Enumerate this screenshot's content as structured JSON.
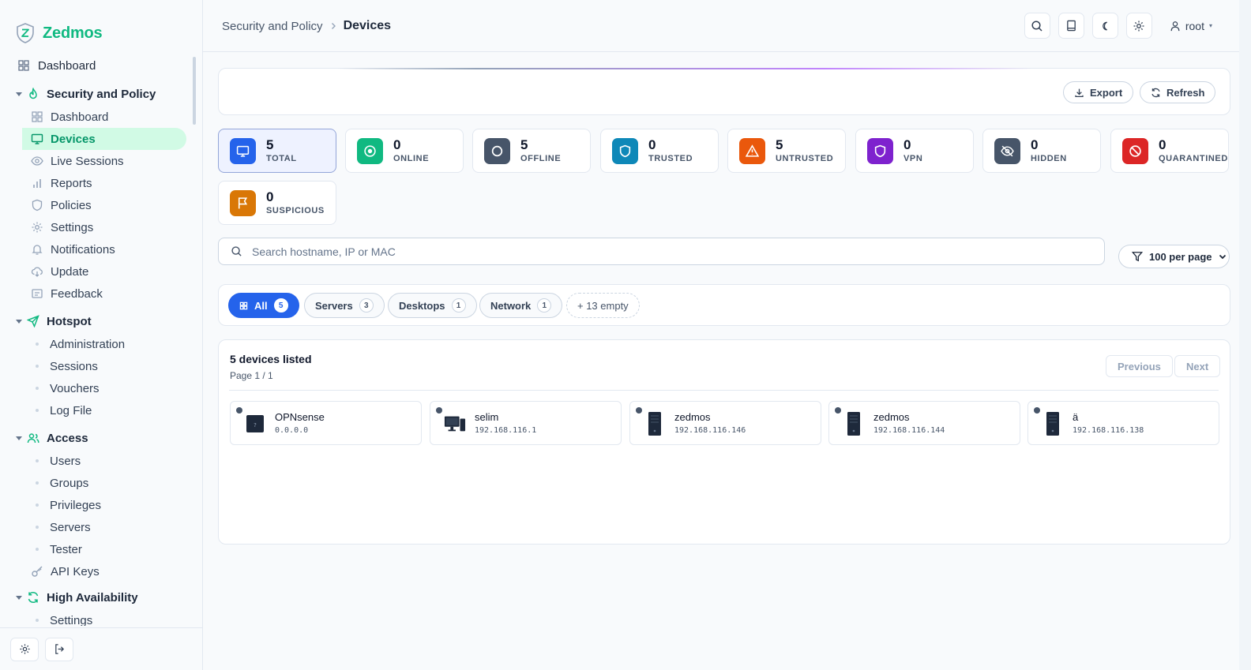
{
  "brand": {
    "name": "Zedmos"
  },
  "sidebar": {
    "top": {
      "label": "Dashboard"
    },
    "groups": [
      {
        "label": "Security and Policy",
        "items": [
          {
            "label": "Dashboard",
            "icon": "grid-icon"
          },
          {
            "label": "Devices",
            "icon": "monitor-icon",
            "active": true
          },
          {
            "label": "Live Sessions",
            "icon": "eye-icon"
          },
          {
            "label": "Reports",
            "icon": "bar-chart-icon"
          },
          {
            "label": "Policies",
            "icon": "shield-icon"
          },
          {
            "label": "Settings",
            "icon": "gear-icon"
          },
          {
            "label": "Notifications",
            "icon": "bell-icon"
          },
          {
            "label": "Update",
            "icon": "cloud-download-icon"
          },
          {
            "label": "Feedback",
            "icon": "feedback-icon"
          }
        ]
      },
      {
        "label": "Hotspot",
        "items": [
          {
            "label": "Administration"
          },
          {
            "label": "Sessions"
          },
          {
            "label": "Vouchers"
          },
          {
            "label": "Log File"
          }
        ]
      },
      {
        "label": "Access",
        "items": [
          {
            "label": "Users"
          },
          {
            "label": "Groups"
          },
          {
            "label": "Privileges"
          },
          {
            "label": "Servers"
          },
          {
            "label": "Tester"
          },
          {
            "label": "API Keys",
            "icon": "key-icon"
          }
        ]
      },
      {
        "label": "High Availability",
        "items": [
          {
            "label": "Settings"
          }
        ]
      }
    ]
  },
  "header": {
    "breadcrumb": [
      "Security and Policy",
      "Devices"
    ],
    "user": "root"
  },
  "toolbar": {
    "export_label": "Export",
    "refresh_label": "Refresh"
  },
  "stats": [
    {
      "value": "5",
      "label": "TOTAL",
      "color": "#2563eb"
    },
    {
      "value": "0",
      "label": "ONLINE",
      "color": "#10b981"
    },
    {
      "value": "5",
      "label": "OFFLINE",
      "color": "#475569"
    },
    {
      "value": "0",
      "label": "TRUSTED",
      "color": "#0e88b8"
    },
    {
      "value": "5",
      "label": "UNTRUSTED",
      "color": "#ea580c"
    },
    {
      "value": "0",
      "label": "VPN",
      "color": "#7e22ce"
    },
    {
      "value": "0",
      "label": "HIDDEN",
      "color": "#475569"
    },
    {
      "value": "0",
      "label": "QUARANTINED",
      "color": "#dc2626"
    },
    {
      "value": "0",
      "label": "SUSPICIOUS",
      "color": "#d97706"
    }
  ],
  "search": {
    "placeholder": "Search hostname, IP or MAC"
  },
  "per_page": "100 per page",
  "filters": [
    {
      "label": "All",
      "count": "5"
    },
    {
      "label": "Servers",
      "count": "3"
    },
    {
      "label": "Desktops",
      "count": "1"
    },
    {
      "label": "Network",
      "count": "1"
    },
    {
      "label": "+ 13 empty"
    }
  ],
  "list": {
    "title": "5 devices listed",
    "page": "Page 1 / 1",
    "prev_label": "Previous",
    "next_label": "Next"
  },
  "devices": [
    {
      "name": "OPNsense",
      "ip": "0.0.0.0"
    },
    {
      "name": "selim",
      "ip": "192.168.116.1"
    },
    {
      "name": "zedmos",
      "ip": "192.168.116.146"
    },
    {
      "name": "zedmos",
      "ip": "192.168.116.144"
    },
    {
      "name": "ä",
      "ip": "192.168.116.138"
    }
  ]
}
